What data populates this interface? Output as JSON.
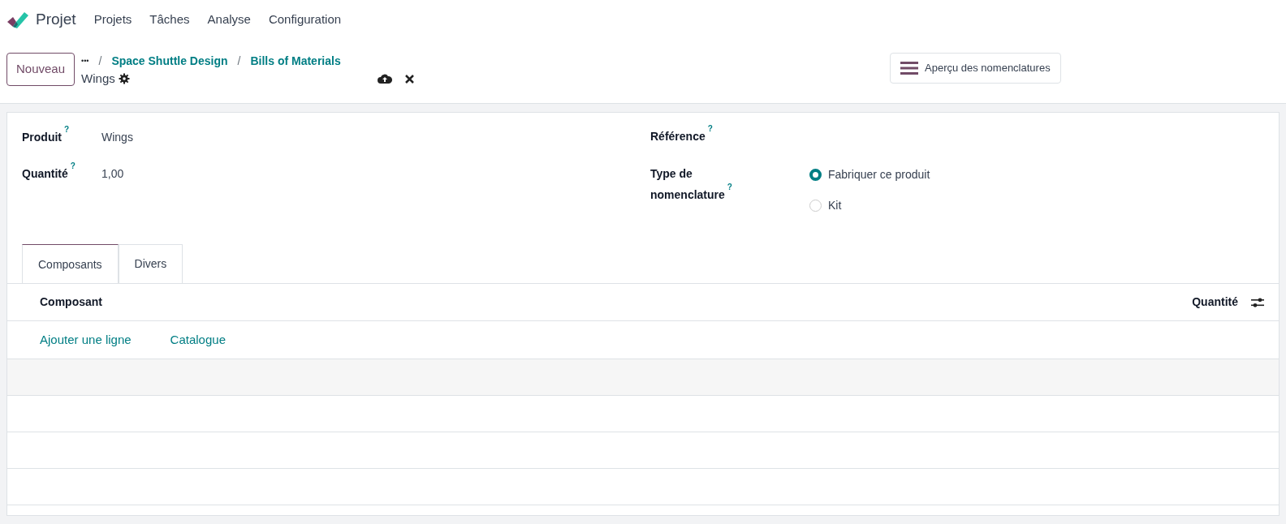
{
  "app": {
    "name": "Projet"
  },
  "menu": [
    {
      "label": "Projets"
    },
    {
      "label": "Tâches"
    },
    {
      "label": "Analyse"
    },
    {
      "label": "Configuration"
    }
  ],
  "control_panel": {
    "new_button": "Nouveau",
    "breadcrumb_more": "•••",
    "breadcrumbs": [
      {
        "separator": "/",
        "label": "Space Shuttle Design"
      },
      {
        "separator": "/",
        "label": "Bills of Materials"
      }
    ],
    "record_title": "Wings",
    "overview_button": "Aperçu des nomenclatures"
  },
  "fields_left": [
    {
      "label": "Produit",
      "help": "?",
      "value": "Wings"
    },
    {
      "label": "Quantité",
      "help": "?",
      "value": "1,00"
    }
  ],
  "fields_right": [
    {
      "label": "Référence",
      "help": "?"
    },
    {
      "label": "Type de nomenclature",
      "help": "?",
      "options": [
        {
          "label": "Fabriquer ce produit",
          "selected": true
        },
        {
          "label": "Kit",
          "selected": false
        }
      ]
    }
  ],
  "tabs": [
    {
      "label": "Composants",
      "selected": true
    },
    {
      "label": "Divers",
      "selected": false
    }
  ],
  "table": {
    "columns": [
      {
        "label": "Composant"
      },
      {
        "label": "Quantité"
      }
    ],
    "add_links": [
      {
        "label": "Ajouter une ligne"
      },
      {
        "label": "Catalogue"
      }
    ]
  }
}
